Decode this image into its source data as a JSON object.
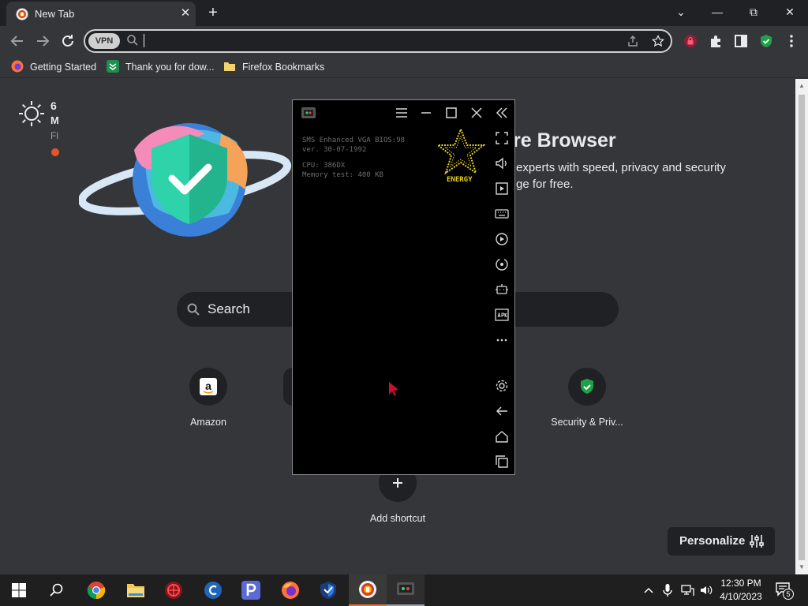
{
  "browser": {
    "tab": {
      "title": "New Tab",
      "close_label": "✕"
    },
    "new_tab_label": "+",
    "window_controls": {
      "tab_search": "⌄",
      "minimize": "—",
      "restore": "⧉",
      "close": "✕"
    },
    "vpn_label": "VPN",
    "address_value": "",
    "bookmarks": [
      {
        "label": "Getting Started",
        "icon": "firefox-icon"
      },
      {
        "label": "Thank you for dow...",
        "icon": "download-bookmark-icon"
      },
      {
        "label": "Firefox Bookmarks",
        "icon": "folder-icon"
      }
    ]
  },
  "newtab": {
    "weather": {
      "temp": "6",
      "desc": "M",
      "location": "Fl"
    },
    "hero": {
      "title": "re Browser",
      "line1": "experts with speed, privacy and security",
      "line2": "ge for free."
    },
    "search_label": "Search",
    "shortcuts": [
      {
        "label": "Amazon",
        "icon": "amazon-icon"
      },
      {
        "label": "Security & Priv...",
        "icon": "shield-check-icon"
      },
      {
        "label": "Add shortcut",
        "icon": "plus-icon"
      }
    ],
    "personalize_label": "Personalize"
  },
  "emulator": {
    "bios_lines": [
      "SMS Enhanced VGA BIOS:98",
      "ver. 30-07-1992",
      "CPU: 386DX",
      "Memory test: 400 KB"
    ],
    "logo_text": "ENERGY",
    "side_icons": [
      "fullscreen-icon",
      "volume-icon",
      "play-box-icon",
      "keyboard-icon",
      "record-icon",
      "rotate-icon",
      "robot-icon",
      "apk-icon",
      "more-icon",
      "settings-icon",
      "back-icon",
      "home-icon",
      "recents-icon"
    ]
  },
  "taskbar": {
    "apps": [
      "windows-start-icon",
      "search-icon",
      "chrome-icon",
      "file-explorer-icon",
      "antivirus-icon",
      "ccleaner-icon",
      "pdf-icon",
      "firefox-icon",
      "vpn-shield-icon",
      "secure-browser-icon",
      "emulator-icon"
    ],
    "time": "12:30 PM",
    "date": "4/10/2023",
    "notifications": "5"
  },
  "colors": {
    "accent_green": "#1fa14a",
    "emulator_star": "#e8d21e",
    "personalize_bg": "#202124"
  }
}
